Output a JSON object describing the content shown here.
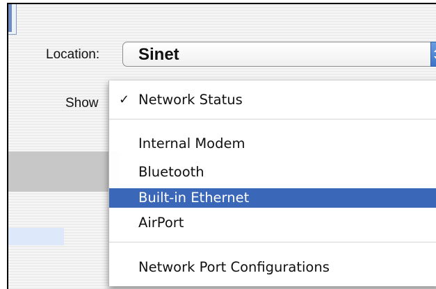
{
  "location": {
    "label": "Location:",
    "value": "Sinet"
  },
  "show": {
    "label": "Show"
  },
  "menu": {
    "selected_check": "✓",
    "items": [
      "Network Status",
      "Internal Modem",
      "Bluetooth",
      "Built-in Ethernet",
      "AirPort",
      "Network Port Configurations"
    ]
  }
}
